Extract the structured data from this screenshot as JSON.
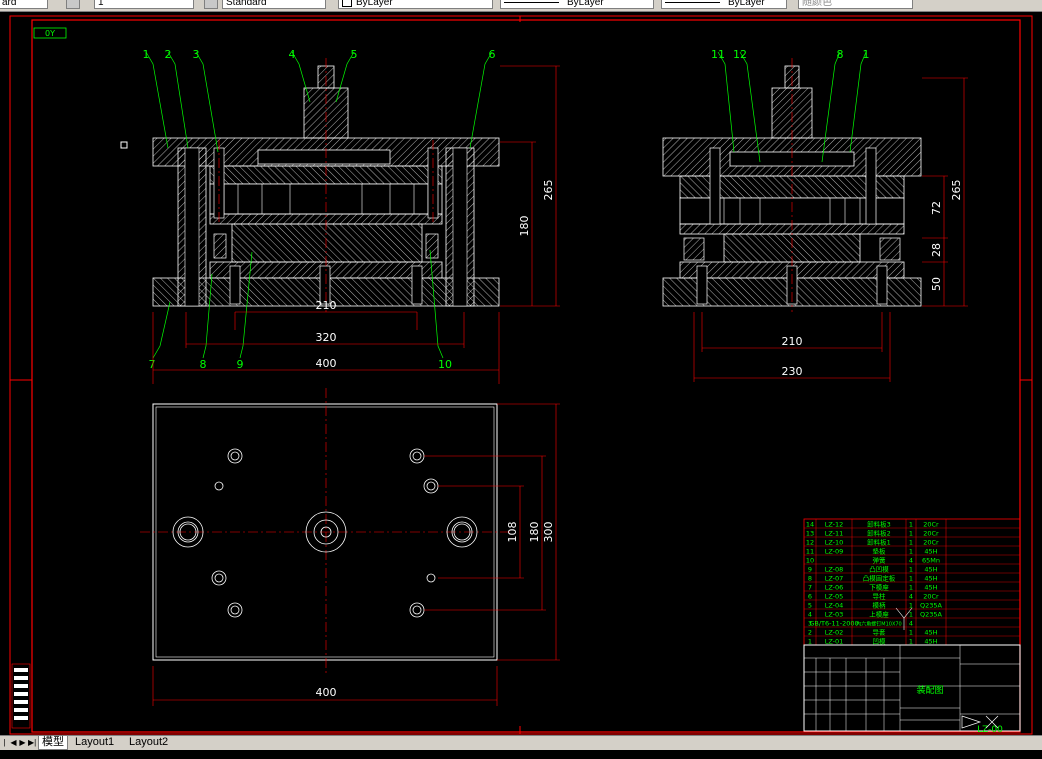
{
  "toolbar": {
    "field_style": "ard",
    "field_linetype_scale": "1",
    "field_textstyle": "Standard",
    "field_layer": "ByLayer",
    "field_linetype": "ByLayer",
    "field_lineweight": "ByLayer",
    "field_color": "随颜色"
  },
  "drawing": {
    "corner_tag": "0Y",
    "part_callouts_front": [
      "1",
      "2",
      "3",
      "4",
      "5",
      "6"
    ],
    "part_callouts_front_bottom": [
      "7",
      "8",
      "9",
      "10"
    ],
    "part_callouts_side": [
      "11",
      "12",
      "8",
      "1"
    ],
    "dims_front": {
      "d210": "210",
      "d320": "320",
      "d400": "400",
      "d265": "265",
      "d180": "180"
    },
    "dims_side": {
      "d210": "210",
      "d230": "230",
      "d265": "265",
      "d72": "72",
      "d28": "28",
      "d50": "50"
    },
    "dims_plan": {
      "d400": "400",
      "d108": "108",
      "d180": "180",
      "d300": "300"
    },
    "title_block": {
      "drawing_no": "LZ-00",
      "title": "装配图"
    },
    "bom": [
      {
        "no": "14",
        "code": "LZ-12",
        "name": "卸料板3",
        "qty": "1",
        "mat": "20Cr"
      },
      {
        "no": "13",
        "code": "LZ-11",
        "name": "卸料板2",
        "qty": "1",
        "mat": "20Cr"
      },
      {
        "no": "12",
        "code": "LZ-10",
        "name": "卸料板1",
        "qty": "1",
        "mat": "20Cr"
      },
      {
        "no": "11",
        "code": "LZ-09",
        "name": "垫板",
        "qty": "1",
        "mat": "45H"
      },
      {
        "no": "10",
        "code": "",
        "name": "弹簧",
        "qty": "4",
        "mat": "65Mn"
      },
      {
        "no": "9",
        "code": "LZ-08",
        "name": "凸凹模",
        "qty": "1",
        "mat": "45H"
      },
      {
        "no": "8",
        "code": "LZ-07",
        "name": "凸模固定板",
        "qty": "1",
        "mat": "45H"
      },
      {
        "no": "7",
        "code": "LZ-06",
        "name": "下模座",
        "qty": "1",
        "mat": "45H"
      },
      {
        "no": "6",
        "code": "LZ-05",
        "name": "导柱",
        "qty": "4",
        "mat": "20Cr"
      },
      {
        "no": "5",
        "code": "LZ-04",
        "name": "模柄",
        "qty": "1",
        "mat": "Q235A"
      },
      {
        "no": "4",
        "code": "LZ-03",
        "name": "上模座",
        "qty": "1",
        "mat": "Q235A"
      },
      {
        "no": "3",
        "code": "GB/T6-11-2000",
        "name": "内六角螺钉M10X70",
        "qty": "4",
        "mat": ""
      },
      {
        "no": "2",
        "code": "LZ-02",
        "name": "导套",
        "qty": "1",
        "mat": "45H"
      },
      {
        "no": "1",
        "code": "LZ-01",
        "name": "凹模",
        "qty": "1",
        "mat": "45H"
      }
    ]
  },
  "tabs": {
    "model": "模型",
    "layout1": "Layout1",
    "layout2": "Layout2"
  },
  "colors": {
    "background": "#000000",
    "frame": "#ff0000",
    "geometry": "#ffffff",
    "text": "#00ff00",
    "hatch": "#ffffff"
  }
}
